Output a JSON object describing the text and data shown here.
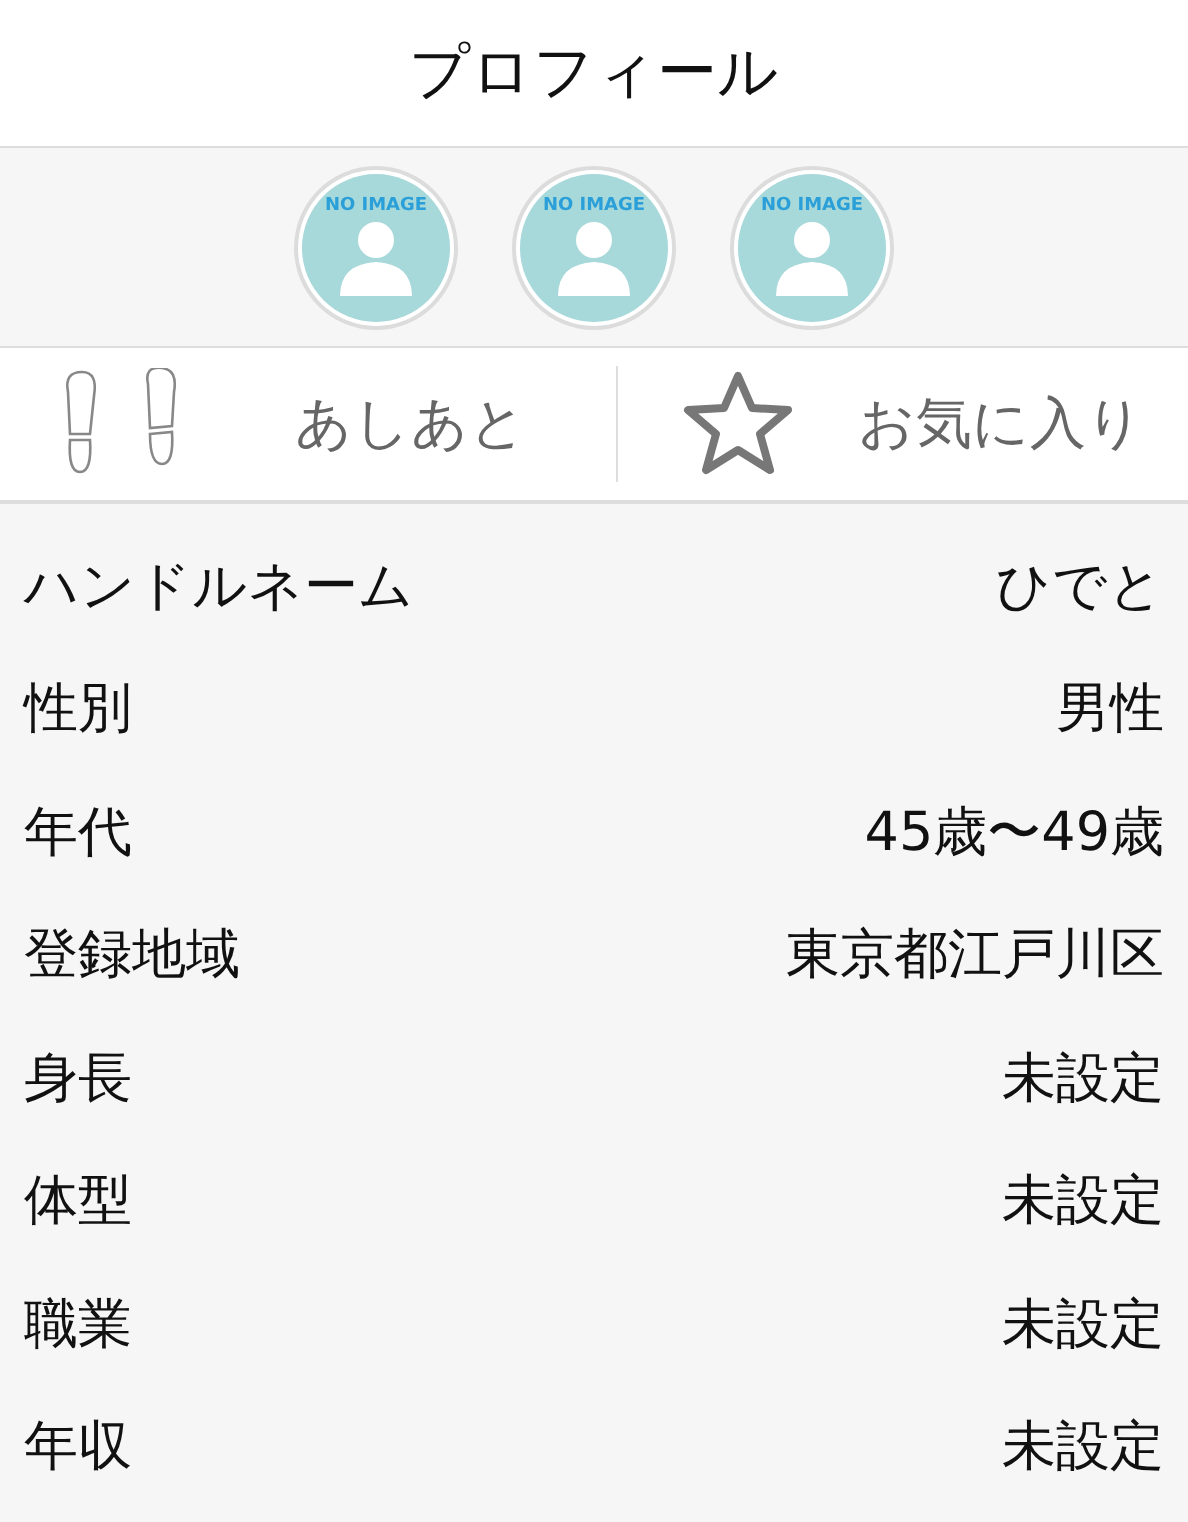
{
  "header": {
    "title": "プロフィール"
  },
  "avatars": [
    {
      "label": "NO IMAGE"
    },
    {
      "label": "NO IMAGE"
    },
    {
      "label": "NO IMAGE"
    }
  ],
  "actions": [
    {
      "kind": "footprints",
      "label": "あしあと"
    },
    {
      "kind": "star",
      "label": "お気に入り"
    }
  ],
  "profile": [
    {
      "label": "ハンドルネーム",
      "value": "ひでと"
    },
    {
      "label": "性別",
      "value": "男性"
    },
    {
      "label": "年代",
      "value": "45歳〜49歳"
    },
    {
      "label": "登録地域",
      "value": "東京都江戸川区"
    },
    {
      "label": "身長",
      "value": "未設定"
    },
    {
      "label": "体型",
      "value": "未設定"
    },
    {
      "label": "職業",
      "value": "未設定"
    },
    {
      "label": "年収",
      "value": "未設定"
    }
  ]
}
